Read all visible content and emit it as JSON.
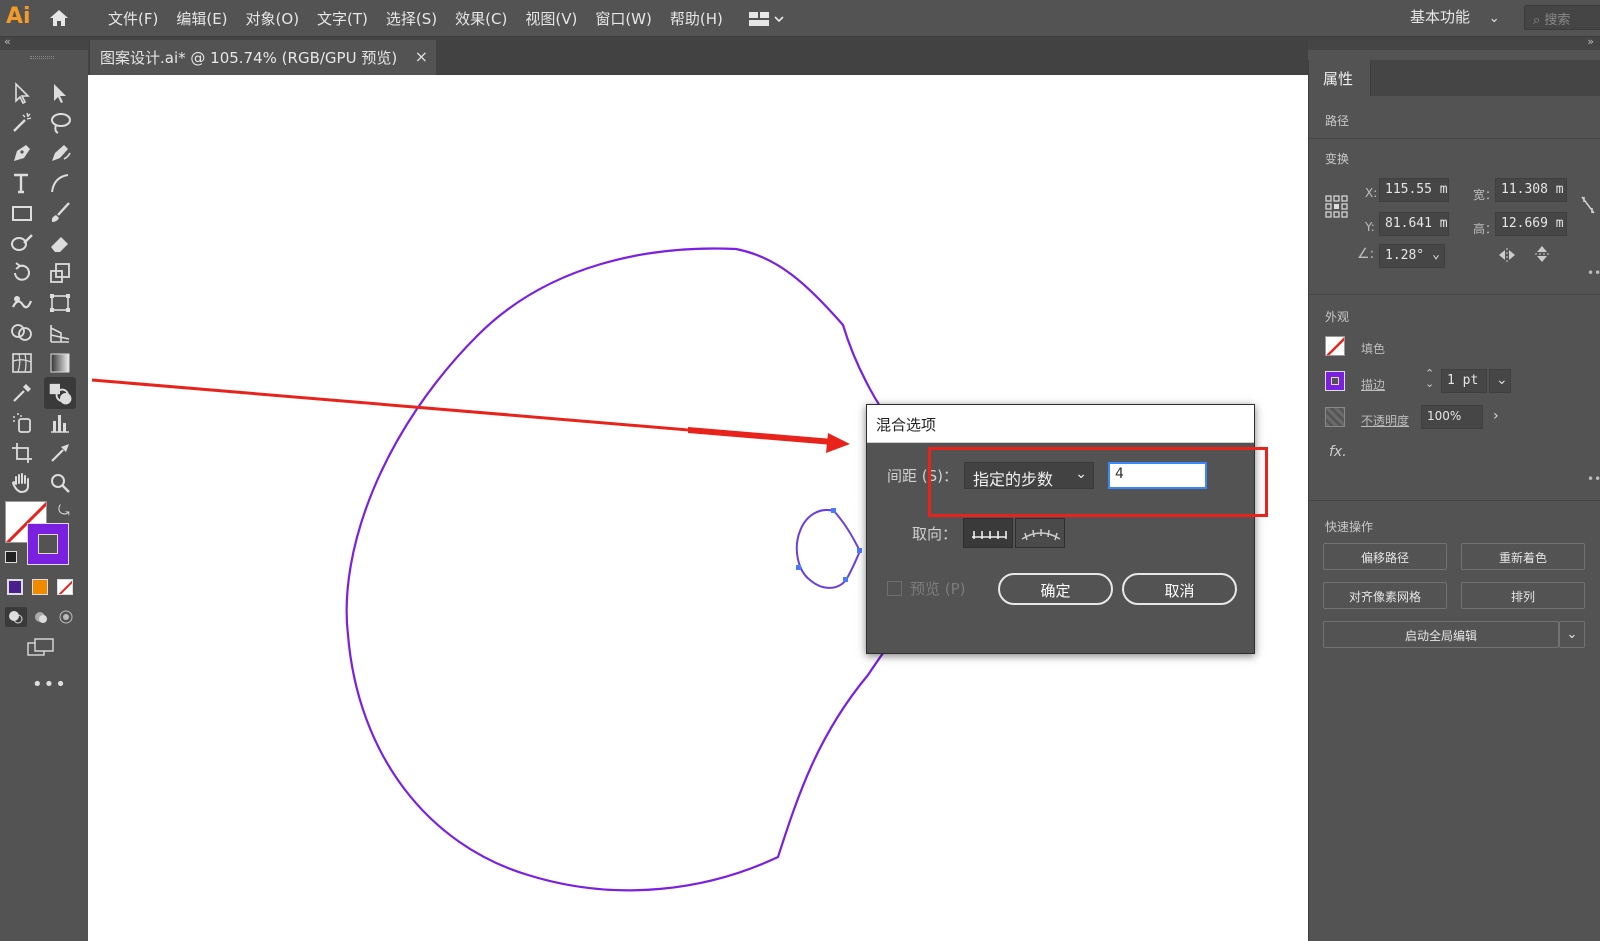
{
  "app": {
    "logo": "Ai"
  },
  "menu": [
    "文件(F)",
    "编辑(E)",
    "对象(O)",
    "文字(T)",
    "选择(S)",
    "效果(C)",
    "视图(V)",
    "窗口(W)",
    "帮助(H)"
  ],
  "workspace": {
    "label": "基本功能",
    "search_placeholder": "搜索"
  },
  "document": {
    "tab_title": "图案设计.ai* @ 105.74% (RGB/GPU 预览)",
    "close": "×"
  },
  "dialog": {
    "title": "混合选项",
    "spacing_label": "间距 (S)：",
    "spacing_option": "指定的步数",
    "steps_value": "4",
    "orientation_label": "取向：",
    "preview_label": "预览 (P)",
    "ok": "确定",
    "cancel": "取消"
  },
  "panel": {
    "tab": "属性",
    "path_label": "路径",
    "transform_label": "变换",
    "x_label": "X:",
    "x_value": "115.55 m",
    "y_label": "Y:",
    "y_value": "81.641 m",
    "w_label": "宽：",
    "w_value": "11.308 m",
    "h_label": "高：",
    "h_value": "12.669 m",
    "angle_value": "1.28°",
    "appearance_label": "外观",
    "fill_label": "填色",
    "stroke_label": "描边",
    "stroke_value": "1 pt",
    "opacity_label": "不透明度",
    "opacity_value": "100%",
    "fx": "fx.",
    "quick_label": "快速操作",
    "btn_offset": "偏移路径",
    "btn_recolor": "重新着色",
    "btn_pixel": "对齐像素网格",
    "btn_arrange": "排列",
    "btn_global": "启动全局编辑"
  },
  "colors": {
    "stroke_color": "#7b1fe0",
    "highlight": "#e8231b",
    "arrow": "#e8231b"
  }
}
